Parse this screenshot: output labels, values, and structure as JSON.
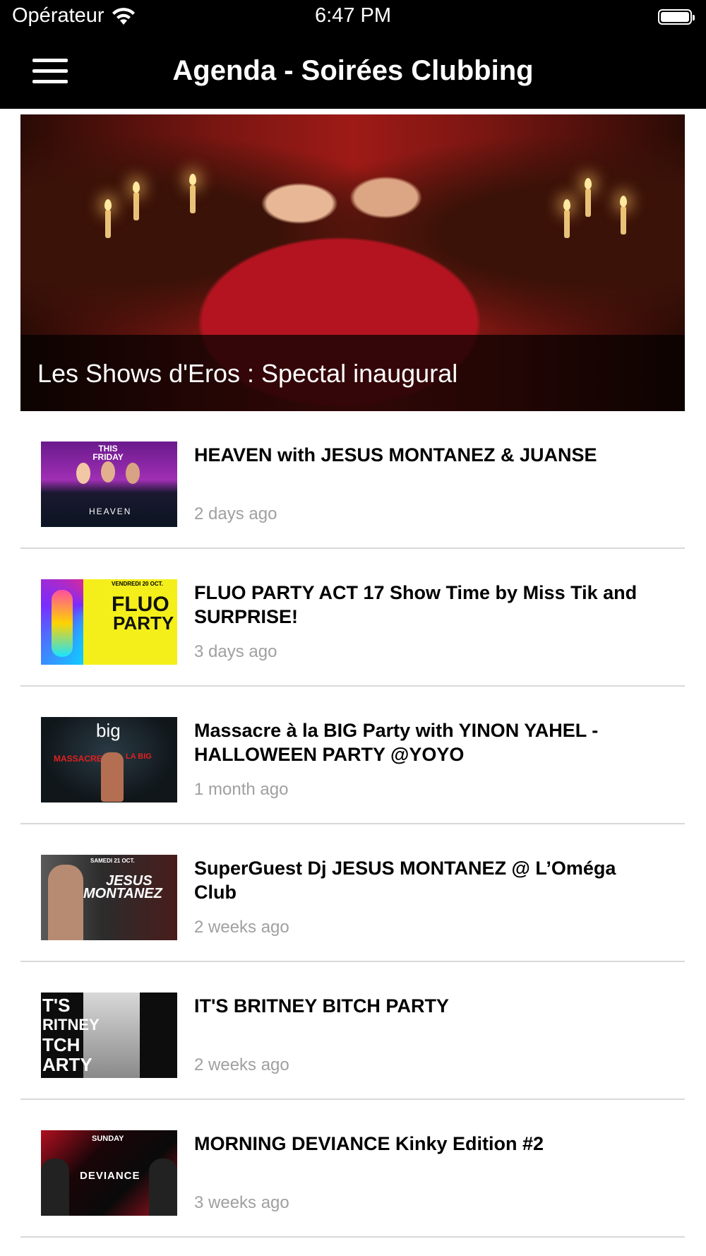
{
  "status_bar": {
    "carrier": "Opérateur",
    "time": "6:47 PM"
  },
  "nav": {
    "title": "Agenda - Soirées Clubbing"
  },
  "featured": {
    "caption": "Les Shows d'Eros : Spectal inaugural"
  },
  "events": [
    {
      "title": "HEAVEN with JESUS MONTANEZ & JUANSE",
      "time": "2 days ago",
      "thumb_text": [
        "THIS FRIDAY",
        "HEAVEN"
      ]
    },
    {
      "title": "FLUO PARTY ACT 17 Show Time by Miss Tik and SURPRISE!",
      "time": "3 days ago",
      "thumb_text": [
        "VENDREDI 20 OCT.",
        "FLUO",
        "PARTY"
      ]
    },
    {
      "title": "Massacre à la BIG Party with YINON YAHEL - HALLOWEEN PARTY @YOYO",
      "time": "1 month ago",
      "thumb_text": [
        "big",
        "MASSACRE",
        "LA BIG"
      ]
    },
    {
      "title": "SuperGuest Dj JESUS MONTANEZ @ L’Oméga Club",
      "time": "2 weeks ago",
      "thumb_text": [
        "SAMEDI 21 OCT.",
        "JESUS",
        "MONTANEZ"
      ]
    },
    {
      "title": "IT'S BRITNEY BITCH PARTY",
      "time": "2 weeks ago",
      "thumb_text": [
        "T'S",
        "RITNEY",
        "TCH",
        "ARTY"
      ]
    },
    {
      "title": "MORNING DEVIANCE Kinky Edition #2",
      "time": "3 weeks ago",
      "thumb_text": [
        "SUNDAY",
        "DEVIANCE"
      ]
    }
  ]
}
